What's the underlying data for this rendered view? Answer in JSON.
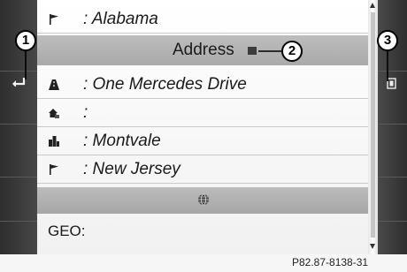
{
  "entries": [
    {
      "label": ": Alabama",
      "icon": "flag-icon"
    },
    {
      "label": ": One Mercedes Drive",
      "icon": "street-icon"
    },
    {
      "label": ":",
      "icon": "house-number-icon"
    },
    {
      "label": ": Montvale",
      "icon": "city-icon"
    },
    {
      "label": ": New Jersey",
      "icon": "flag-icon"
    }
  ],
  "highlight": {
    "label": "Address"
  },
  "geo_label": "GEO:",
  "callouts": [
    "1",
    "2",
    "3"
  ],
  "credit": "P82.87-8138-31",
  "colors": {
    "screen_bg": "#3b3b3b",
    "list_bg": "#ffffff",
    "highlight": "#b4b4b4"
  }
}
